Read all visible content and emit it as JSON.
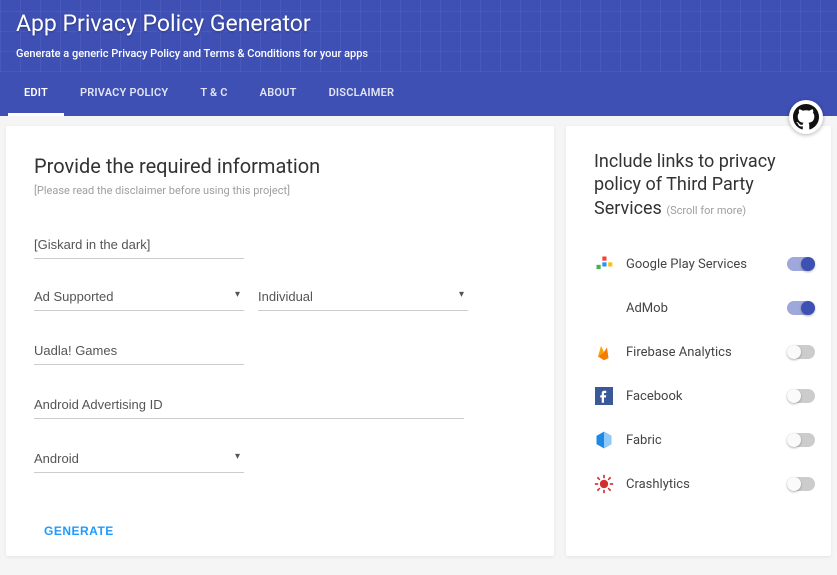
{
  "header": {
    "title": "App Privacy Policy Generator",
    "subtitle": "Generate a generic Privacy Policy and Terms & Conditions for your apps"
  },
  "tabs": [
    "EDIT",
    "PRIVACY POLICY",
    "T & C",
    "ABOUT",
    "DISCLAIMER"
  ],
  "active_tab": 0,
  "form": {
    "heading": "Provide the required information",
    "disclaimer": "[Please read the disclaimer before using this project]",
    "app_name": "[Giskard in the dark]",
    "monetization": "Ad Supported",
    "entity": "Individual",
    "developer": "Uadla! Games",
    "pii": "Android Advertising ID",
    "platform": "Android",
    "generate_label": "GENERATE"
  },
  "services_panel": {
    "heading_line1": "Include links to privacy policy of Third Party Services",
    "scroll_hint": "(Scroll for more)"
  },
  "services": [
    {
      "name": "Google Play Services",
      "on": true,
      "icon": "puzzle"
    },
    {
      "name": "AdMob",
      "on": true,
      "icon": "admob"
    },
    {
      "name": "Firebase Analytics",
      "on": false,
      "icon": "firebase"
    },
    {
      "name": "Facebook",
      "on": false,
      "icon": "facebook"
    },
    {
      "name": "Fabric",
      "on": false,
      "icon": "fabric"
    },
    {
      "name": "Crashlytics",
      "on": false,
      "icon": "crashlytics"
    }
  ]
}
